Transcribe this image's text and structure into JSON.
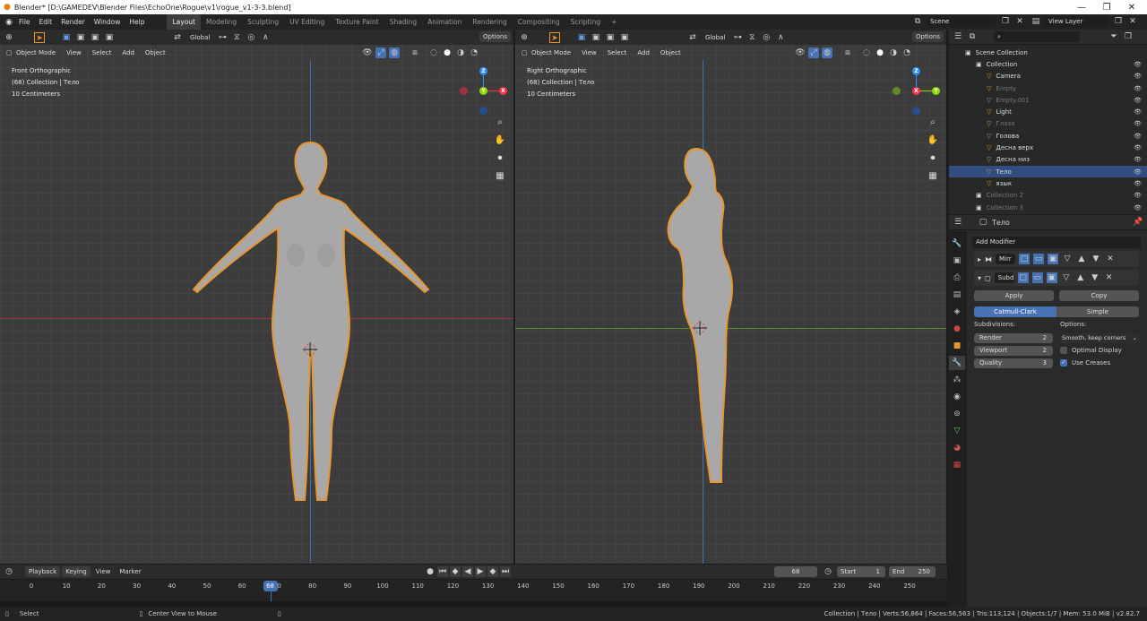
{
  "window": {
    "title": "Blender* [D:\\GAMEDEV\\Blender Files\\EchoOne\\Rogue\\v1\\rogue_v1-3-3.blend]"
  },
  "menu": [
    "File",
    "Edit",
    "Render",
    "Window",
    "Help"
  ],
  "workspaces": [
    "Layout",
    "Modeling",
    "Sculpting",
    "UV Editing",
    "Texture Paint",
    "Shading",
    "Animation",
    "Rendering",
    "Compositing",
    "Scripting"
  ],
  "active_workspace": "Layout",
  "scene": "Scene",
  "view_layer": "View Layer",
  "viewports": [
    {
      "mode": "Object Mode",
      "menus": [
        "View",
        "Select",
        "Add",
        "Object"
      ],
      "transform": "Global",
      "options": "Options",
      "view_name": "Front Orthographic",
      "collection": "(68) Collection | Тело",
      "scale": "10 Centimeters",
      "axes": {
        "up": "Z",
        "right": "X",
        "center": "Y"
      }
    },
    {
      "mode": "Object Mode",
      "menus": [
        "View",
        "Select",
        "Add",
        "Object"
      ],
      "transform": "Global",
      "options": "Options",
      "view_name": "Right Orthographic",
      "collection": "(68) Collection | Тело",
      "scale": "10 Centimeters",
      "axes": {
        "up": "Z",
        "right": "Y",
        "center": "X"
      }
    }
  ],
  "outliner": {
    "search_placeholder": "",
    "rows": [
      {
        "label": "Scene Collection",
        "indent": 0,
        "dim": false,
        "sel": false
      },
      {
        "label": "Collection",
        "indent": 1,
        "dim": false,
        "sel": false
      },
      {
        "label": "Camera",
        "indent": 2,
        "dim": false,
        "sel": false
      },
      {
        "label": "Empty",
        "indent": 2,
        "dim": true,
        "sel": false
      },
      {
        "label": "Empty.001",
        "indent": 2,
        "dim": true,
        "sel": false
      },
      {
        "label": "Light",
        "indent": 2,
        "dim": false,
        "sel": false
      },
      {
        "label": "Глаза",
        "indent": 2,
        "dim": true,
        "sel": false
      },
      {
        "label": "Голова",
        "indent": 2,
        "dim": false,
        "sel": false
      },
      {
        "label": "Десна верх",
        "indent": 2,
        "dim": false,
        "sel": false
      },
      {
        "label": "Десна низ",
        "indent": 2,
        "dim": false,
        "sel": false
      },
      {
        "label": "Тело",
        "indent": 2,
        "dim": false,
        "sel": true
      },
      {
        "label": "язык",
        "indent": 2,
        "dim": false,
        "sel": false
      },
      {
        "label": "Collection 2",
        "indent": 1,
        "dim": true,
        "sel": false
      },
      {
        "label": "Collection 3",
        "indent": 1,
        "dim": true,
        "sel": false
      }
    ]
  },
  "properties": {
    "object_name": "Тело",
    "add_modifier": "Add Modifier",
    "modifiers": [
      {
        "name": "Mirr"
      },
      {
        "name": "Subd"
      }
    ],
    "apply": "Apply",
    "copy": "Copy",
    "catmull": "Catmull-Clark",
    "simple": "Simple",
    "subdivisions_label": "Subdivisions:",
    "options_label": "Options:",
    "render_label": "Render",
    "render_value": "2",
    "viewport_label": "Viewport",
    "viewport_value": "2",
    "quality_label": "Quality",
    "quality_value": "3",
    "uv_smooth": "Smooth, keep corners",
    "optimal_display": "Optimal Display",
    "use_creases": "Use Creases",
    "optimal_checked": false,
    "creases_checked": true
  },
  "timeline": {
    "menus": [
      "Playback",
      "Keying",
      "View",
      "Marker"
    ],
    "current_frame": "68",
    "start_label": "Start",
    "start": "1",
    "end_label": "End",
    "end": "250",
    "ticks": [
      0,
      10,
      20,
      30,
      40,
      50,
      60,
      70,
      80,
      90,
      100,
      110,
      120,
      130,
      140,
      150,
      160,
      170,
      180,
      190,
      200,
      210,
      220,
      230,
      240,
      250
    ],
    "playhead_frame": 68
  },
  "statusbar": {
    "left1": "Select",
    "left2": "Center View to Mouse",
    "right": "Collection | Тело | Verts:56,864 | Faces:56,563 | Tris:113,124 | Objects:1/7 | Mem: 53.0 MiB | v2.82.7"
  },
  "colors": {
    "accent": "#4772b3",
    "selection_outline": "#e8962d",
    "x_axis": "#ff3352",
    "y_axis": "#8bdc00",
    "z_axis": "#2890ff"
  }
}
